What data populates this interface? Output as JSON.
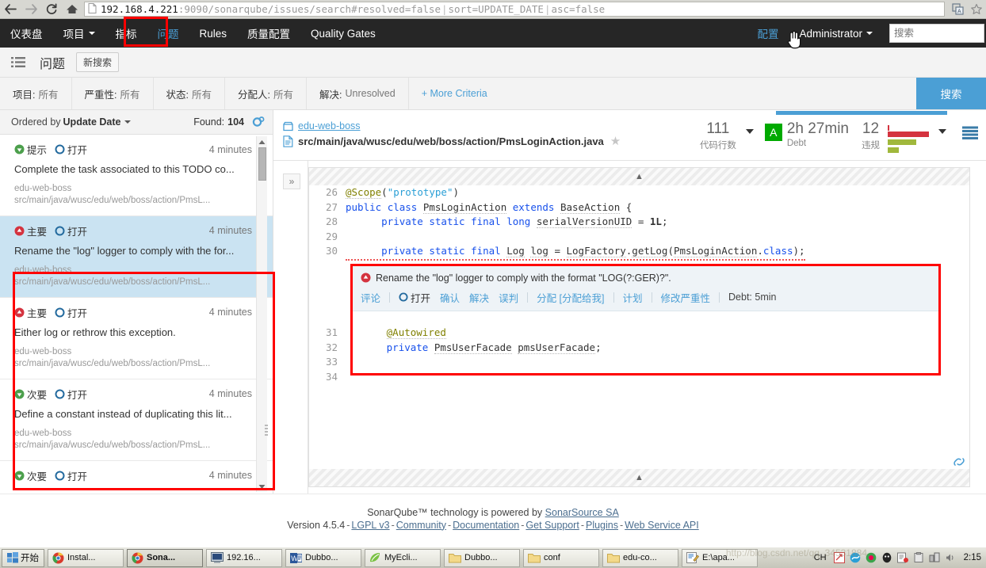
{
  "browser": {
    "back_icon": "back-arrow-icon",
    "forward_icon": "forward-arrow-icon",
    "reload_icon": "reload-icon",
    "home_icon": "home-icon",
    "url_host": "192.168.4.221",
    "url_rest": ":9090/sonarqube/issues/search#resolved=false",
    "url_param1": "sort=UPDATE_DATE",
    "url_param2": "asc=false",
    "translate_icon": "translate-icon",
    "bookmark_icon": "star-icon"
  },
  "topnav": {
    "items": [
      {
        "label": "仪表盘",
        "caret": false,
        "active": false
      },
      {
        "label": "项目",
        "caret": true,
        "active": false
      },
      {
        "label": "指标",
        "caret": false,
        "active": false
      },
      {
        "label": "问题",
        "caret": false,
        "active": true
      },
      {
        "label": "Rules",
        "caret": false,
        "active": false
      },
      {
        "label": "质量配置",
        "caret": false,
        "active": false
      },
      {
        "label": "Quality Gates",
        "caret": false,
        "active": false
      }
    ],
    "settings_label": "配置",
    "user_label": "Administrator",
    "search_placeholder": "搜索",
    "search_value": ""
  },
  "pagehead": {
    "list_icon": "list-icon",
    "title": "问题",
    "new_search_label": "新搜索"
  },
  "filters": {
    "facets": [
      {
        "label": "项目:",
        "value": "所有"
      },
      {
        "label": "严重性:",
        "value": "所有"
      },
      {
        "label": "状态:",
        "value": "所有"
      },
      {
        "label": "分配人:",
        "value": "所有"
      },
      {
        "label": "解决:",
        "value": "Unresolved"
      }
    ],
    "more_label": "+ More Criteria",
    "search_button": "搜索",
    "accent_color": "#4b9fd5"
  },
  "issues_panel": {
    "ordered_by_label": "Ordered by",
    "ordered_by_value": "Update Date",
    "found_label": "Found:",
    "found_count": "104",
    "gear_icon": "gear-icon",
    "items": [
      {
        "severity": "提示",
        "severity_kind": "info",
        "status": "打开",
        "age": "4 minutes",
        "message": "Complete the task associated to this TODO co...",
        "project": "edu-web-boss",
        "path": "src/main/java/wusc/edu/web/boss/action/PmsL...",
        "selected": false
      },
      {
        "severity": "主要",
        "severity_kind": "major",
        "status": "打开",
        "age": "4 minutes",
        "message": "Rename the \"log\" logger to comply with the for...",
        "project": "edu-web-boss",
        "path": "src/main/java/wusc/edu/web/boss/action/PmsL...",
        "selected": true
      },
      {
        "severity": "主要",
        "severity_kind": "major",
        "status": "打开",
        "age": "4 minutes",
        "message": "Either log or rethrow this exception.",
        "project": "edu-web-boss",
        "path": "src/main/java/wusc/edu/web/boss/action/PmsL...",
        "selected": false
      },
      {
        "severity": "次要",
        "severity_kind": "minor",
        "status": "打开",
        "age": "4 minutes",
        "message": "Define a constant instead of duplicating this lit...",
        "project": "edu-web-boss",
        "path": "src/main/java/wusc/edu/web/boss/action/PmsL...",
        "selected": false
      },
      {
        "severity": "次要",
        "severity_kind": "minor",
        "status": "打开",
        "age": "4 minutes",
        "message": "",
        "project": "",
        "path": "",
        "selected": false
      }
    ]
  },
  "source": {
    "project_name": "edu-web-boss",
    "file_path": "src/main/java/wusc/edu/web/boss/action/PmsLoginAction.java",
    "favorite_icon": "star-icon",
    "measures": {
      "ncloc_value": "111",
      "ncloc_label": "代码行数",
      "rating": "A",
      "debt_value": "2h 27min",
      "debt_label": "Debt",
      "violations_value": "12",
      "violations_label": "违规"
    },
    "expand_icon": "chevron-right-icon",
    "lines": [
      {
        "num": "26",
        "html": "<span class=\"ann u\">@Scope</span><span class=\"code\">(</span><span class=\"str\">\"prototype\"</span><span class=\"code\">)</span>"
      },
      {
        "num": "27",
        "html": "<span class=\"k\">public</span> <span class=\"k\">class</span> <span class=\"u\">PmsLoginAction</span> <span class=\"k\">extends</span> <span class=\"u\">BaseAction</span> {"
      },
      {
        "num": "28",
        "html": "        <span class=\"k\">private</span> <span class=\"k\">static</span> <span class=\"k\">final</span> <span class=\"k\">long</span> <span class=\"u\">serialVersionUID</span> = <span class=\"num\">1L</span>;"
      },
      {
        "num": "29",
        "html": ""
      },
      {
        "num": "30",
        "html": "        <span class=\"k\">private</span> <span class=\"k\">static</span> <span class=\"k\">final</span> <span class=\"u\">Log</span> <span class=\"u\">log</span> = <span class=\"u\">LogFactory</span>.<span class=\"u\">getLog</span>(<span class=\"u\">PmsLoginAction</span>.<span class=\"k\">class</span>);"
      }
    ],
    "lines_after": [
      {
        "num": "31",
        "html": "        <span class=\"ann u\">@Autowired</span>"
      },
      {
        "num": "32",
        "html": "        <span class=\"k\">private</span> <span class=\"u\">PmsUserFacade</span> <span class=\"u\">pmsUserFacade</span>;"
      },
      {
        "num": "33",
        "html": ""
      },
      {
        "num": "34",
        "html": ""
      }
    ]
  },
  "issue_box": {
    "title": "Rename the \"log\" logger to comply with the format \"LOG(?:GER)?\".",
    "severity_kind": "major",
    "actions": [
      {
        "label": "评论",
        "type": "link"
      },
      {
        "label": "打开",
        "type": "status"
      },
      {
        "label": "确认",
        "type": "link"
      },
      {
        "label": "解决",
        "type": "link"
      },
      {
        "label": "误判",
        "type": "link"
      },
      {
        "label": "分配 [分配给我]",
        "type": "link"
      },
      {
        "label": "计划",
        "type": "link"
      },
      {
        "label": "修改严重性",
        "type": "link"
      }
    ],
    "debt_label": "Debt: 5min",
    "rule_icon": "rule-link-icon"
  },
  "footer": {
    "line1_pre": "SonarQube™ technology is powered by",
    "line1_link": "SonarSource SA",
    "version": "Version 4.5.4",
    "links": [
      "LGPL v3",
      "Community",
      "Documentation",
      "Get Support",
      "Plugins",
      "Web Service API"
    ]
  },
  "taskbar": {
    "start_label": "开始",
    "items": [
      {
        "label": "Instal...",
        "icon": "chrome-icon",
        "active": false
      },
      {
        "label": "Sona...",
        "icon": "chrome-icon",
        "active": true
      },
      {
        "label": "192.16...",
        "icon": "remote-desktop-icon",
        "active": false
      },
      {
        "label": "Dubbo...",
        "icon": "word-icon",
        "active": false
      },
      {
        "label": "MyEcli...",
        "icon": "myeclipse-icon",
        "active": false
      },
      {
        "label": "Dubbo...",
        "icon": "folder-icon",
        "active": false
      },
      {
        "label": "conf",
        "icon": "folder-icon",
        "active": false
      },
      {
        "label": "edu-co...",
        "icon": "folder-icon",
        "active": false
      },
      {
        "label": "E:\\apa...",
        "icon": "editplus-icon",
        "active": false
      }
    ],
    "ime_label": "CH",
    "clock": "2:15"
  },
  "watermark": "http://blog.csdn.net/qq_34531884"
}
